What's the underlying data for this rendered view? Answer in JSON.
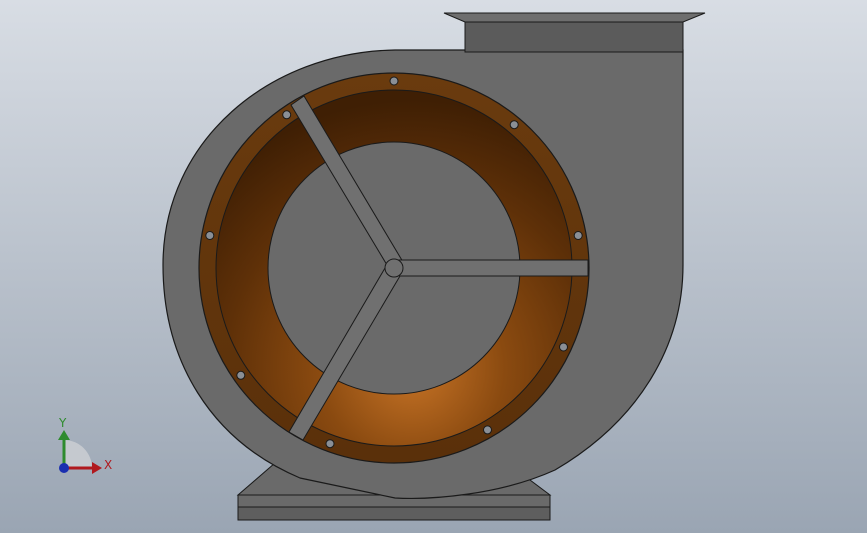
{
  "viewport": {
    "background_top": "#d8dde4",
    "background_bottom": "#9aa5b3"
  },
  "model": {
    "housing_color": "#6a6a6a",
    "outline_color": "#1a1a1a",
    "inner_ring_color": "#6b3a0c",
    "inner_ring_highlight": "#b0651c",
    "inner_ring_shadow": "#4a2505",
    "spoke_color": "#707070"
  },
  "triad": {
    "x_label": "X",
    "y_label": "Y",
    "x_color": "#b0191e",
    "y_color": "#2e8b2e",
    "z_color": "#1a2fb0"
  }
}
